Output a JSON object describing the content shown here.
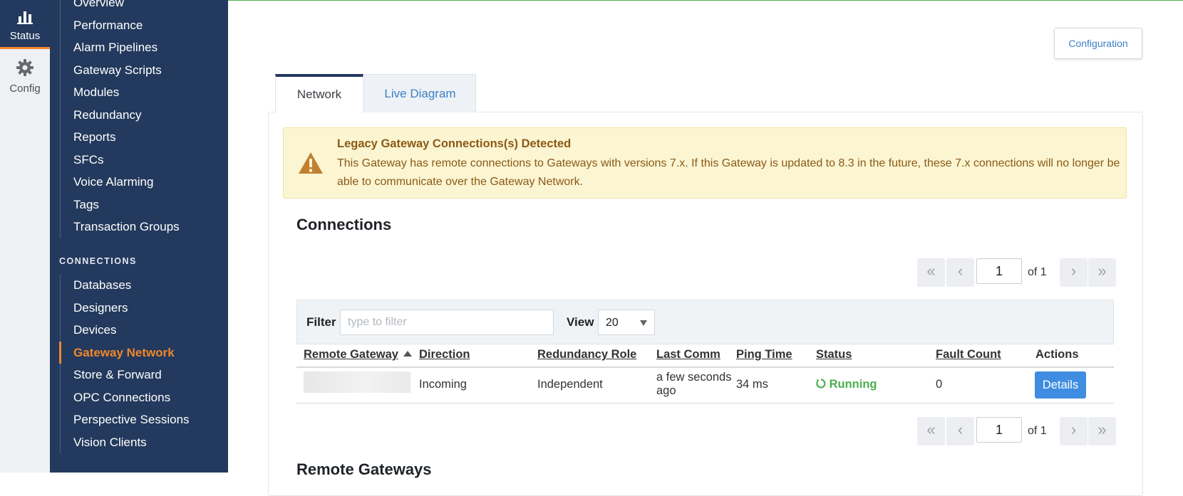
{
  "rail": {
    "items": [
      {
        "label": "Status",
        "icon": "bar-chart-icon"
      },
      {
        "label": "Config",
        "icon": "gear-icon"
      }
    ]
  },
  "sidebar": {
    "top_partial": "Overview",
    "status_items": [
      "Performance",
      "Alarm Pipelines",
      "Gateway Scripts",
      "Modules",
      "Redundancy",
      "Reports",
      "SFCs",
      "Voice Alarming",
      "Tags",
      "Transaction Groups"
    ],
    "section_title": "CONNECTIONS",
    "connection_items": [
      "Databases",
      "Designers",
      "Devices",
      "Gateway Network",
      "Store & Forward",
      "OPC Connections",
      "Perspective Sessions",
      "Vision Clients"
    ],
    "active_item": "Gateway Network"
  },
  "main": {
    "config_button": "Configuration",
    "tabs": [
      {
        "label": "Network",
        "active": true
      },
      {
        "label": "Live Diagram",
        "active": false
      }
    ],
    "alert": {
      "icon": "warning-triangle-icon",
      "title": "Legacy Gateway Connections(s) Detected",
      "body": "This Gateway has remote connections to Gateways with versions 7.x. If this Gateway is updated to 8.3 in the future, these 7.x connections will no longer be able to communicate over the Gateway Network."
    },
    "connections_title": "Connections",
    "pager": {
      "first": "«",
      "prev": "‹",
      "page": "1",
      "of": "of 1",
      "next": "›",
      "last": "»"
    },
    "filter": {
      "label": "Filter",
      "placeholder": "type to filter",
      "view_label": "View",
      "view_value": "20"
    },
    "table": {
      "columns": [
        "Remote Gateway",
        "Direction",
        "Redundancy Role",
        "Last Comm",
        "Ping Time",
        "Status",
        "Fault Count",
        "Actions"
      ],
      "rows": [
        {
          "remote_gateway": "",
          "direction": "Incoming",
          "redundancy_role": "Independent",
          "last_comm_1": "a few seconds",
          "last_comm_2": "ago",
          "ping_time": "34 ms",
          "status": "Running",
          "fault_count": "0",
          "action": "Details"
        }
      ]
    },
    "remote_gateways_title": "Remote Gateways"
  },
  "colors": {
    "sidebar_bg": "#23395d",
    "accent": "#f0872a",
    "link": "#3d7fc4",
    "running": "#4caf50",
    "alert_bg": "#fcf5d2",
    "alert_text": "#8a5a17",
    "button_primary": "#3f8de0"
  }
}
